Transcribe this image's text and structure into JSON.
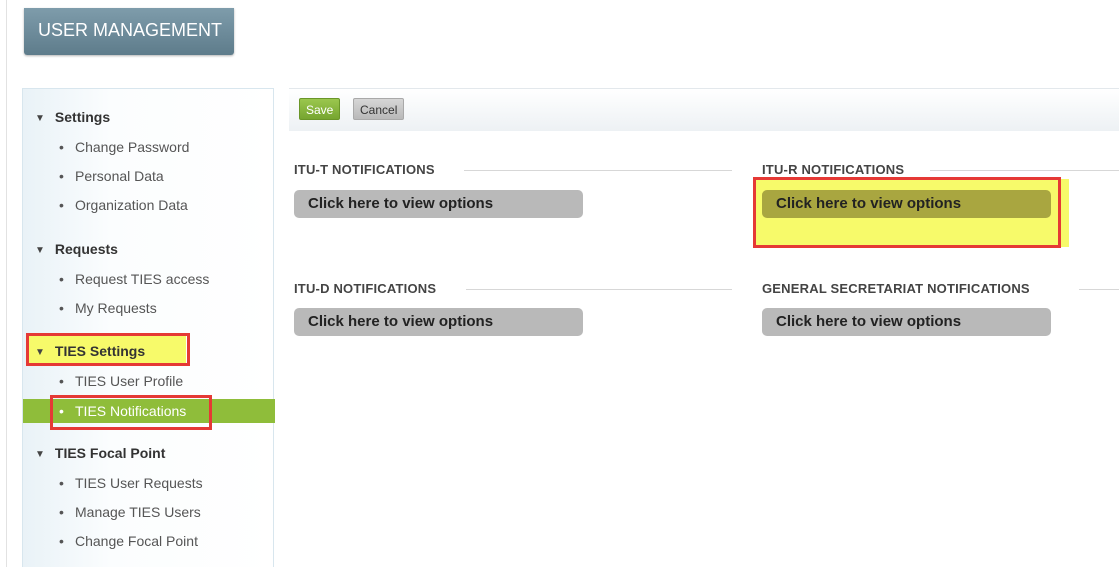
{
  "header": {
    "title": "USER MANAGEMENT"
  },
  "sidebar": {
    "sections": [
      {
        "title": "Settings",
        "items": [
          "Change Password",
          "Personal Data",
          "Organization Data"
        ]
      },
      {
        "title": "Requests",
        "items": [
          "Request TIES access",
          "My Requests"
        ]
      },
      {
        "title": "TIES Settings",
        "items": [
          "TIES User Profile",
          "TIES Notifications"
        ]
      },
      {
        "title": "TIES Focal Point",
        "items": [
          "TIES User Requests",
          "Manage TIES Users",
          "Change Focal Point"
        ]
      }
    ],
    "active_item": "TIES Notifications"
  },
  "toolbar": {
    "save_label": "Save",
    "cancel_label": "Cancel"
  },
  "notifications": {
    "itu_t": {
      "title": "ITU-T NOTIFICATIONS",
      "button": "Click here to view options"
    },
    "itu_r": {
      "title": "ITU-R NOTIFICATIONS",
      "button": "Click here to view options"
    },
    "itu_d": {
      "title": "ITU-D NOTIFICATIONS",
      "button": "Click here to view options"
    },
    "general": {
      "title": "GENERAL SECRETARIAT NOTIFICATIONS",
      "button": "Click here to view options"
    }
  },
  "colors": {
    "header_bg": "#6e8c9b",
    "active_green": "#8fbd3a",
    "highlight_red": "#e53935",
    "highlight_yellow": "#f7fa6a",
    "option_gray": "#b9b9b9",
    "option_olive": "#a9a640"
  }
}
